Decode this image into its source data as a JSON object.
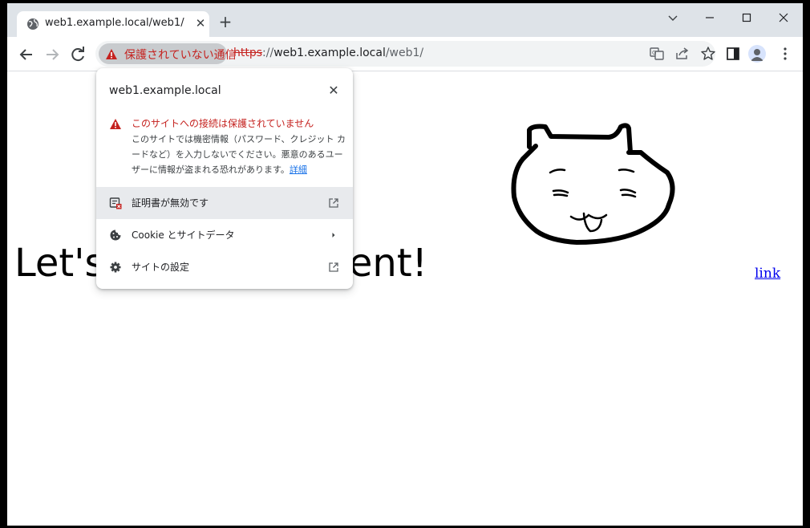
{
  "tab": {
    "title": "web1.example.local/web1/",
    "icon": "globe-icon"
  },
  "address_bar": {
    "security_chip": "保護されていない通信",
    "url_scheme": "https",
    "url_host_sep": "://",
    "url_host": "web1.example.local",
    "url_path": "/web1/"
  },
  "page": {
    "heading_left": "Let's",
    "heading_right": "nent!",
    "link": "link"
  },
  "site_info_popup": {
    "domain": "web1.example.local",
    "warning_title": "このサイトへの接続は保護されていません",
    "warning_desc": "このサイトでは機密情報（パスワード、クレジット カードなど）を入力しないでください。悪意のあるユーザーに情報が盗まれる恐れがあります。",
    "learn_more": "詳細",
    "items": [
      {
        "label": "証明書が無効です",
        "icon": "certificate-icon",
        "end_icon": "external-link-icon"
      },
      {
        "label": "Cookie とサイトデータ",
        "icon": "cookie-icon",
        "end_icon": "chevron-right-icon"
      },
      {
        "label": "サイトの設定",
        "icon": "gear-icon",
        "end_icon": "external-link-icon"
      }
    ]
  },
  "colors": {
    "danger": "#c5221f",
    "link": "#1a73e8",
    "tabstrip": "#dee3e8"
  }
}
